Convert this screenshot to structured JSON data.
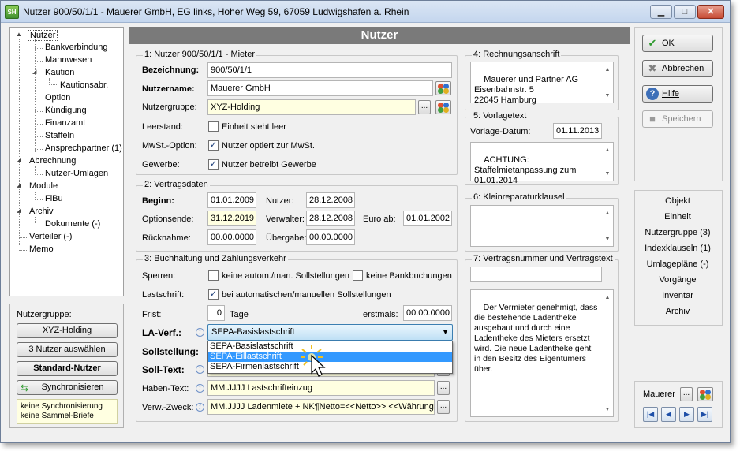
{
  "window": {
    "title": "Nutzer 900/50/1/1 - Mauerer GmbH, EG links, Hoher Weg 59, 67059 Ludwigshafen a. Rhein",
    "app_icon_label": "SH",
    "minimize": "▁",
    "maximize": "□",
    "close": "✕"
  },
  "tree": {
    "items": [
      {
        "label": "Nutzer",
        "expander": "▲"
      },
      {
        "label": "Bankverbindung"
      },
      {
        "label": "Mahnwesen"
      },
      {
        "label": "Kaution",
        "expander": "◢"
      },
      {
        "label": "Kautionsabr."
      },
      {
        "label": "Option"
      },
      {
        "label": "Kündigung"
      },
      {
        "label": "Finanzamt"
      },
      {
        "label": "Staffeln"
      },
      {
        "label": "Ansprechpartner (1)"
      },
      {
        "label": "Abrechnung",
        "expander": "◢"
      },
      {
        "label": "Nutzer-Umlagen"
      },
      {
        "label": "Module",
        "expander": "◢"
      },
      {
        "label": "FiBu"
      },
      {
        "label": "Archiv",
        "expander": "◢"
      },
      {
        "label": "Dokumente (-)"
      },
      {
        "label": "Verteiler (-)"
      },
      {
        "label": "Memo"
      }
    ]
  },
  "nutzergruppe_panel": {
    "title": "Nutzergruppe:",
    "group_button": "XYZ-Holding",
    "select_button": "3 Nutzer auswählen",
    "standard_button": "Standard-Nutzer",
    "sync_button": "Synchronisieren",
    "sync_note": "keine Synchronisierung\nkeine Sammel-Briefe"
  },
  "main": {
    "header": "Nutzer",
    "section1": {
      "caption": "1: Nutzer 900/50/1/1 - Mieter",
      "bezeichnung_label": "Bezeichnung:",
      "bezeichnung_value": "900/50/1/1",
      "nutzername_label": "Nutzername:",
      "nutzername_value": "Mauerer GmbH",
      "nutzergruppe_label": "Nutzergruppe:",
      "nutzergruppe_value": "XYZ-Holding",
      "leerstand_label": "Leerstand:",
      "leerstand_text": "Einheit steht leer",
      "leerstand_checked": "",
      "mwst_label": "MwSt.-Option:",
      "mwst_text": "Nutzer optiert zur MwSt.",
      "mwst_checked": "✓",
      "gewerbe_label": "Gewerbe:",
      "gewerbe_text": "Nutzer betreibt Gewerbe",
      "gewerbe_checked": "✓",
      "dots": "..."
    },
    "section2": {
      "caption": "2: Vertragsdaten",
      "beginn_label": "Beginn:",
      "beginn_value": "01.01.2009",
      "nutzer_label": "Nutzer:",
      "nutzer_value": "28.12.2008",
      "optionsende_label": "Optionsende:",
      "optionsende_value": "31.12.2019",
      "verwalter_label": "Verwalter:",
      "verwalter_value": "28.12.2008",
      "euro_label": "Euro ab:",
      "euro_value": "01.01.2002",
      "rueckname_label": "Rücknahme:",
      "rueckname_value": "00.00.0000",
      "uebergabe_label": "Übergabe:",
      "uebergabe_value": "00.00.0000"
    },
    "section3": {
      "caption": "3: Buchhaltung und Zahlungsverkehr",
      "sperren_label": "Sperren:",
      "sperre1_text": "keine autom./man. Sollstellungen",
      "sperre1_checked": "",
      "sperre2_text": "keine Bankbuchungen",
      "sperre2_checked": "",
      "lastschrift_label": "Lastschrift:",
      "lastschrift_text": "bei automatischen/manuellen Sollstellungen",
      "lastschrift_checked": "✓",
      "frist_label": "Frist:",
      "frist_value": "0",
      "tage_label": "Tage",
      "erstmals_label": "erstmals:",
      "erstmals_value": "00.00.0000",
      "laverf_label": "LA-Verf.:",
      "laverf_value": "SEPA-Basislastschrift",
      "laverf_options": [
        "SEPA-Basislastschrift",
        "SEPA-Eillastschrift",
        "SEPA-Firmenlastschrift"
      ],
      "sollstellung_label": "Sollstellung:",
      "solltext_label": "Soll-Text:",
      "habentext_label": "Haben-Text:",
      "habentext_value": "MM.JJJJ Lastschrifteinzug",
      "verwzweck_label": "Verw.-Zweck:",
      "verwzweck_value": "MM.JJJJ Ladenmiete + NK¶Netto=<<Netto>> <<Währung>>",
      "info_glyph": "i"
    },
    "section4": {
      "caption": "4: Rechnungsanschrift",
      "address": "Mauerer und Partner AG\nEisenbahnstr. 5\n22045 Hamburg"
    },
    "section5": {
      "caption": "5: Vorlagetext",
      "datum_label": "Vorlage-Datum:",
      "datum_value": "01.11.2013",
      "text": "ACHTUNG:\nStaffelmietanpassung zum\n01.01.2014"
    },
    "section6": {
      "caption": "6: Kleinreparaturklausel"
    },
    "section7": {
      "caption": "7: Vertragsnummer und Vertragstext",
      "text": "Der Vermieter genehmigt, dass\ndie bestehende Ladentheke\nausgebaut und durch eine\nLadentheke des Mieters ersetzt\nwird. Die neue Ladentheke geht\nin den Besitz des Eigentümers\nüber."
    }
  },
  "right": {
    "ok": "OK",
    "abbrechen": "Abbrechen",
    "hilfe": "Hilfe",
    "speichern": "Speichern",
    "ok_icon": "✔",
    "cancel_icon": "✖",
    "help_icon": "?",
    "save_icon": "■",
    "links": [
      "Objekt",
      "Einheit",
      "Nutzergruppe (3)",
      "Indexklauseln (1)",
      "Umlagepläne (-)",
      "Vorgänge",
      "Inventar",
      "Archiv"
    ],
    "nav_label": "Mauerer",
    "nav_first": "|◀",
    "nav_prev": "◀",
    "nav_next": "▶",
    "nav_last": "▶|"
  },
  "colors": {
    "header_bg": "#7a7a7a",
    "highlight": "#3399ff",
    "yellow_field": "#ffffe1"
  }
}
